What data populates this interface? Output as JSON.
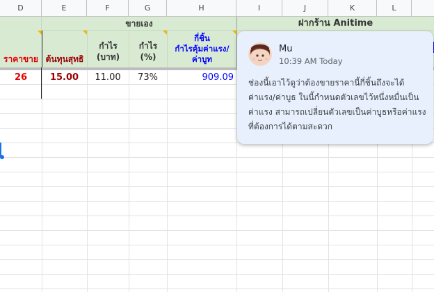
{
  "columns": [
    "D",
    "E",
    "F",
    "G",
    "H",
    "I",
    "J",
    "K",
    "L"
  ],
  "group_headers": {
    "sell_self": "ขายเอง",
    "consign": "ฝากร้าน Anitime"
  },
  "headers": {
    "price": "ราคาขาย",
    "net_cost": "ต้นทุนสุทธิ",
    "profit_baht": "กำไร\n(บาท)",
    "profit_pct": "กำไร\n(%)",
    "pieces": "กี่ชิ้น\nกำไรคุ้มค่าแรง/\nค่าบูท"
  },
  "row": {
    "price": "26",
    "net_cost": "15.00",
    "profit_baht": "11.00",
    "profit_pct": "73%",
    "pieces": "909.09"
  },
  "comment": {
    "author": "Mu",
    "time": "10:39 AM Today",
    "text": "ช่องนี้เอาไว้ดูว่าต้องขายราคานี้กี่ชิ้นถึงจะได้ค่าแรง/ค่าบูธ ในนี้กำหนดตัวเลขไว้หนึ่งหมื่นเป็นค่าแรง สามารถเปลี่ยนตัวเลขเป็นค่าบูธหรือค่าแรงที่ต้องการได้ตามสะดวก"
  },
  "colors": {
    "header_green": "#d9ead3",
    "red_text": "#e00000",
    "dark_red_text": "#990000",
    "blue_text": "#0000ff",
    "comment_bg": "#e8f0fe",
    "selection_blue": "#1a73e8"
  }
}
